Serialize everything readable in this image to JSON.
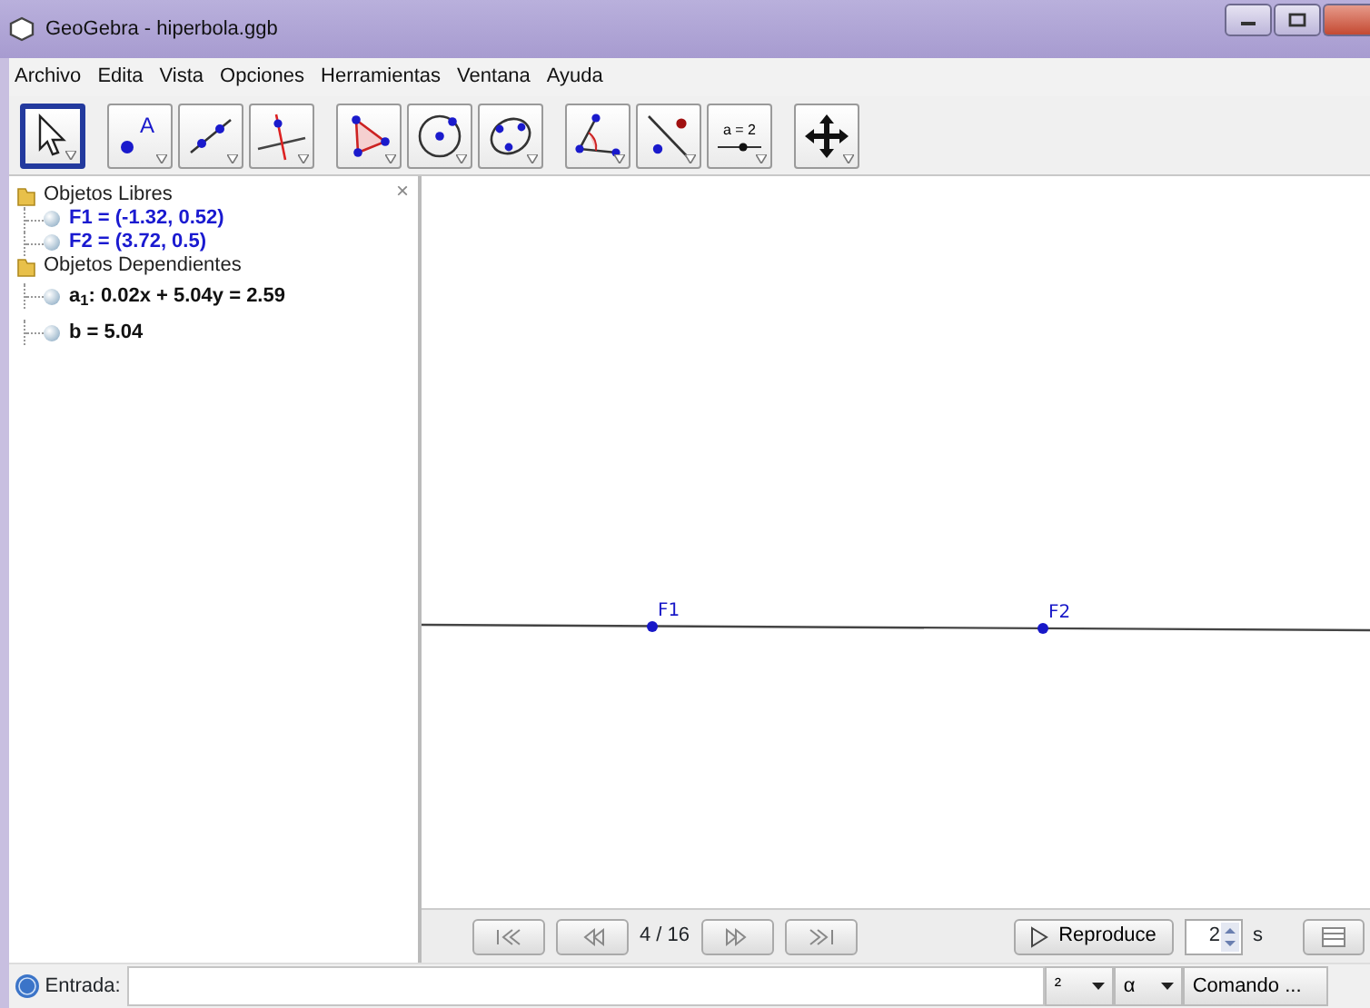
{
  "window": {
    "title": "GeoGebra - hiperbola.ggb"
  },
  "menu": [
    "Archivo",
    "Edita",
    "Vista",
    "Opciones",
    "Herramientas",
    "Ventana",
    "Ayuda"
  ],
  "tools": [
    {
      "kind": "move",
      "selected": true
    },
    {
      "kind": "point",
      "selected": false,
      "label": "A"
    },
    {
      "kind": "line",
      "selected": false
    },
    {
      "kind": "perpendicular",
      "selected": false
    },
    {
      "kind": "polygon",
      "selected": false
    },
    {
      "kind": "circle",
      "selected": false
    },
    {
      "kind": "conic",
      "selected": false
    },
    {
      "kind": "angle",
      "selected": false
    },
    {
      "kind": "reflect",
      "selected": false
    },
    {
      "kind": "slider",
      "selected": false,
      "label": "a = 2"
    },
    {
      "kind": "pan",
      "selected": false
    }
  ],
  "algebra": {
    "close": "×",
    "folders": [
      {
        "label": "Objetos Libres",
        "children": [
          {
            "text": "F1 = (-1.32, 0.52)",
            "color": "#1a1ad0"
          },
          {
            "text": "F2 = (3.72, 0.5)",
            "color": "#1a1ad0"
          }
        ]
      },
      {
        "label": "Objetos Dependientes",
        "children": [
          {
            "text": "a$_{1}$: 0.02x + 5.04y = 2.59",
            "color": "#111111"
          },
          {
            "text": "b = 5.04",
            "color": "#111111"
          }
        ]
      }
    ]
  },
  "graphics": {
    "points": [
      {
        "label": "F1"
      },
      {
        "label": "F2"
      }
    ]
  },
  "navigation": {
    "step": "4 / 16",
    "play": "Reproduce",
    "speed": "2",
    "unit": "s"
  },
  "input_bar": {
    "label": "Entrada:",
    "symbols": "²",
    "greek": "α",
    "command": "Comando ..."
  }
}
